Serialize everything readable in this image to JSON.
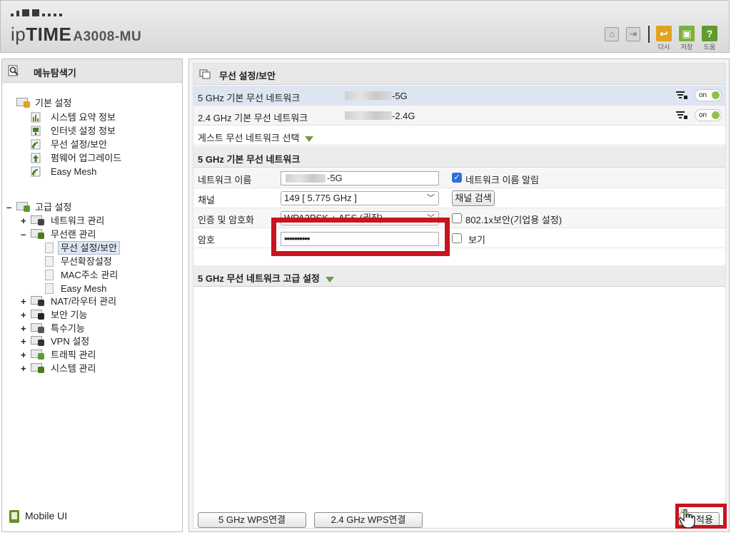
{
  "header": {
    "brand_prefix": "ip",
    "brand_main": "TIME",
    "model": "A3008-MU",
    "buttons": [
      {
        "icon": "reload-icon",
        "label": "다시",
        "color": "#e0a21f",
        "glyph": "↩"
      },
      {
        "icon": "save-icon",
        "label": "저장",
        "color": "#7bb13c",
        "glyph": "▣"
      },
      {
        "icon": "help-icon",
        "label": "도움",
        "color": "#5f9b2e",
        "glyph": "?"
      }
    ]
  },
  "sidebar": {
    "title": "메뉴탐색기",
    "basic": {
      "label": "기본 설정",
      "items": [
        "시스템 요약 정보",
        "인터넷 설정 정보",
        "무선 설정/보안",
        "펌웨어 업그레이드",
        "Easy Mesh"
      ]
    },
    "advanced": {
      "toggle": "–",
      "label": "고급 설정",
      "groups": [
        {
          "toggle": "+",
          "label": "네트워크 관리"
        },
        {
          "toggle": "–",
          "label": "무선랜 관리",
          "children": [
            "무선 설정/보안",
            "무선확장설정",
            "MAC주소 관리",
            "Easy Mesh"
          ]
        },
        {
          "toggle": "+",
          "label": "NAT/라우터 관리"
        },
        {
          "toggle": "+",
          "label": "보안 기능"
        },
        {
          "toggle": "+",
          "label": "특수기능"
        },
        {
          "toggle": "+",
          "label": "VPN 설정"
        },
        {
          "toggle": "+",
          "label": "트래픽 관리"
        },
        {
          "toggle": "+",
          "label": "시스템 관리"
        }
      ]
    },
    "mobile_label": "Mobile UI"
  },
  "main": {
    "title": "무선 설정/보안",
    "networks": [
      {
        "label": "5 GHz 기본 무선 네트워크",
        "ssid_suffix": "-5G",
        "toggle": "on"
      },
      {
        "label": "2.4 GHz 기본 무선 네트워크",
        "ssid_suffix": "-2.4G",
        "toggle": "on"
      }
    ],
    "guest_label": "게스트 무선 네트워크 선택",
    "section_label": "5 GHz 기본 무선 네트워크",
    "form": {
      "name_label": "네트워크 이름",
      "name_suffix": "-5G",
      "broadcast_label": "네트워크 이름 알림",
      "channel_label": "채널",
      "channel_value": "149 [ 5.775 GHz ]",
      "channel_scan": "채널 검색",
      "auth_label": "인증 및 암호화",
      "auth_value": "WPA2PSK + AES (권장)",
      "dot1x_label": "802.1x보안(기업용 설정)",
      "password_label": "암호",
      "password_value": "••••••••••",
      "show_label": "보기"
    },
    "advanced_label": "5 GHz 무선 네트워크 고급 설정",
    "wps_5g": "5 GHz WPS연결",
    "wps_24g": "2.4 GHz WPS연결",
    "apply": "적용"
  },
  "colors": {
    "highlight_red": "#c8141e",
    "toggle_green": "#8ec14b",
    "selected_row": "#dde5f2"
  }
}
